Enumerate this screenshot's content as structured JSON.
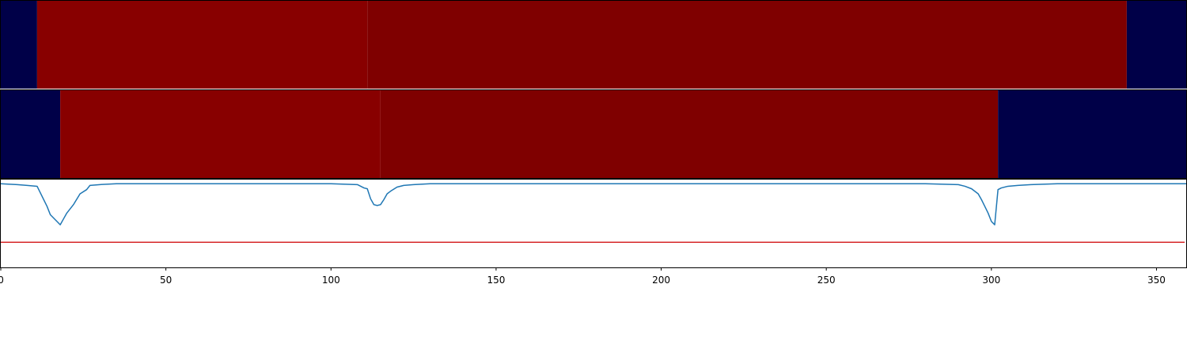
{
  "chart_data": {
    "type": "heatmap",
    "xlim": [
      0,
      359
    ],
    "x_ticks": [
      "0",
      "50",
      "100",
      "150",
      "200",
      "250",
      "300",
      "350"
    ],
    "x_tick_values": [
      0,
      50,
      100,
      150,
      200,
      250,
      300,
      350
    ],
    "rows": [
      {
        "name": "",
        "segments": [
          {
            "start": 0,
            "end": 11,
            "color": "#000048"
          },
          {
            "start": 11,
            "end": 111,
            "color": "#880000"
          },
          {
            "start": 111,
            "end": 341,
            "color": "#7f0000"
          },
          {
            "start": 341,
            "end": 359,
            "color": "#000048"
          }
        ]
      },
      {
        "name": "",
        "segments": [
          {
            "start": 0,
            "end": 18,
            "color": "#000048"
          },
          {
            "start": 18,
            "end": 115,
            "color": "#880000"
          },
          {
            "start": 115,
            "end": 302,
            "color": "#7f0000"
          },
          {
            "start": 302,
            "end": 359,
            "color": "#000048"
          }
        ]
      }
    ],
    "line_panel": {
      "ylim": [
        -1.0,
        0.05
      ],
      "threshold": -0.7,
      "threshold_color": "#d62728",
      "series_color": "#1f77b4",
      "series": {
        "x": [
          0,
          5,
          8,
          11,
          14,
          15,
          16,
          17,
          18,
          19,
          20,
          22,
          24,
          26,
          27,
          30,
          35,
          40,
          100,
          108,
          110,
          111,
          112,
          113,
          114,
          115,
          116,
          117,
          118,
          120,
          122,
          125,
          130,
          200,
          280,
          290,
          292,
          294,
          296,
          297,
          298,
          299,
          300,
          301,
          302,
          303,
          305,
          308,
          312,
          320,
          359
        ],
        "y": [
          0.0,
          -0.01,
          -0.02,
          -0.03,
          -0.27,
          -0.37,
          -0.41,
          -0.45,
          -0.49,
          -0.42,
          -0.35,
          -0.25,
          -0.12,
          -0.07,
          -0.02,
          -0.01,
          0.0,
          0.0,
          0.0,
          -0.01,
          -0.05,
          -0.06,
          -0.18,
          -0.25,
          -0.26,
          -0.25,
          -0.19,
          -0.12,
          -0.09,
          -0.04,
          -0.02,
          -0.01,
          0.0,
          0.0,
          0.0,
          -0.01,
          -0.03,
          -0.06,
          -0.12,
          -0.19,
          -0.27,
          -0.35,
          -0.45,
          -0.49,
          -0.07,
          -0.05,
          -0.03,
          -0.02,
          -0.01,
          0.0,
          0.0
        ]
      }
    }
  }
}
